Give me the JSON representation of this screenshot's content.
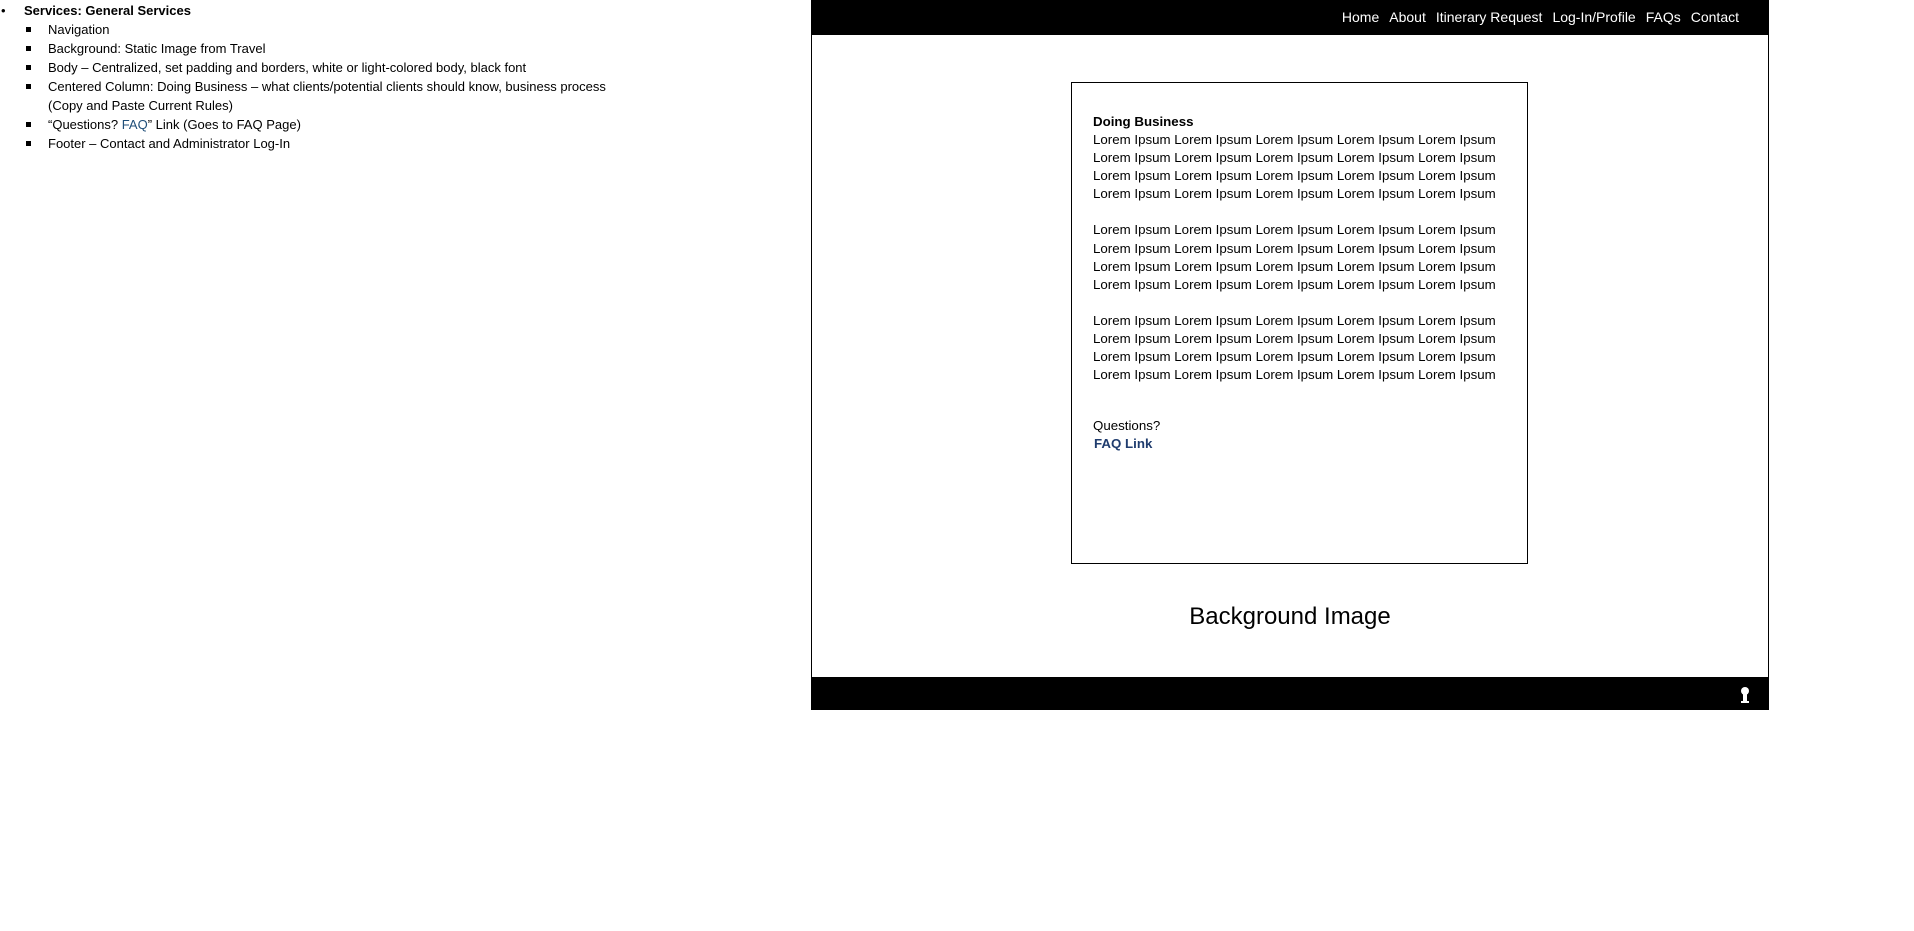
{
  "notes": {
    "title": "Services: General Services",
    "items": [
      "Navigation",
      "Background: Static Image from Travel",
      "Body – Centralized, set padding and borders, white or light-colored body, black font",
      "Centered Column: Doing Business – what clients/potential clients should know, business process\n(Copy and Paste Current Rules)"
    ],
    "faq_item": {
      "prefix": "“Questions? ",
      "link": "FAQ",
      "suffix": "” Link (Goes to FAQ Page)"
    },
    "last_item": "Footer – Contact and Administrator Log-In"
  },
  "nav": {
    "links": [
      "Home",
      "About",
      "Itinerary Request",
      "Log-In/Profile",
      "FAQs",
      "Contact"
    ]
  },
  "content": {
    "heading": "Doing Business",
    "paragraphs": [
      "Lorem Ipsum Lorem Ipsum Lorem Ipsum Lorem Ipsum Lorem Ipsum\nLorem Ipsum Lorem Ipsum Lorem Ipsum Lorem Ipsum Lorem Ipsum\nLorem Ipsum Lorem Ipsum Lorem Ipsum Lorem Ipsum Lorem Ipsum\nLorem Ipsum Lorem Ipsum Lorem Ipsum Lorem Ipsum Lorem Ipsum",
      "Lorem Ipsum Lorem Ipsum Lorem Ipsum Lorem Ipsum Lorem Ipsum\nLorem Ipsum Lorem Ipsum Lorem Ipsum Lorem Ipsum Lorem Ipsum\nLorem Ipsum Lorem Ipsum Lorem Ipsum Lorem Ipsum Lorem Ipsum\nLorem Ipsum Lorem Ipsum Lorem Ipsum Lorem Ipsum Lorem Ipsum",
      "Lorem Ipsum Lorem Ipsum Lorem Ipsum Lorem Ipsum Lorem Ipsum\nLorem Ipsum Lorem Ipsum Lorem Ipsum Lorem Ipsum Lorem Ipsum\nLorem Ipsum Lorem Ipsum Lorem Ipsum Lorem Ipsum Lorem Ipsum\nLorem Ipsum Lorem Ipsum Lorem Ipsum Lorem Ipsum Lorem Ipsum"
    ],
    "questions_label": "Questions?",
    "faq_link_label": "FAQ Link"
  },
  "background_label": "Background Image",
  "footer": {
    "admin_icon": "keyhole-icon"
  },
  "colors": {
    "bar": "#000000",
    "link": "#1f3c6e"
  }
}
